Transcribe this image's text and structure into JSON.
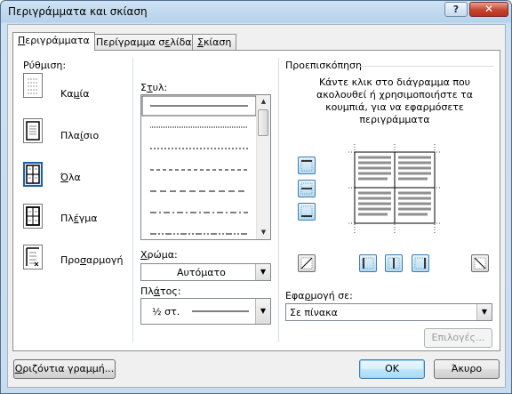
{
  "window": {
    "title": "Περιγράμματα και σκίαση",
    "help_label": "?",
    "close_label": "✕"
  },
  "tabs": [
    {
      "pre": "",
      "u": "Π",
      "post": "εριγράμματα"
    },
    {
      "pre": "Περίγραμμα σ",
      "u": "ε",
      "post": "λίδας"
    },
    {
      "pre": "",
      "u": "Σ",
      "post": "κίαση"
    }
  ],
  "setting": {
    "title": "Ρύθμιση:",
    "items": [
      {
        "label": "Καμία",
        "pre": "Κα",
        "u": "μ",
        "post": "ία",
        "icon": "border-none-icon"
      },
      {
        "label": "Πλαίσιο",
        "pre": "Πλα",
        "u": "ί",
        "post": "σιο",
        "icon": "border-box-icon"
      },
      {
        "label": "Όλα",
        "pre": "",
        "u": "Ό",
        "post": "λα",
        "icon": "border-all-icon",
        "selected": true
      },
      {
        "label": "Πλέγμα",
        "pre": "Πλ",
        "u": "έ",
        "post": "γμα",
        "icon": "border-grid-icon"
      },
      {
        "label": "Προσαρμογή",
        "pre": "Προ",
        "u": "σ",
        "post": "αρμογή",
        "icon": "border-custom-icon"
      }
    ]
  },
  "style": {
    "title_pre": "Σ",
    "title_u": "τ",
    "title_post": "υλ:",
    "line_styles": [
      "solid",
      "dotted-fine",
      "dotted",
      "dashed",
      "dashed-long",
      "dash-dot",
      "dash-dot-dot"
    ]
  },
  "color": {
    "label_pre": "",
    "label_u": "Χ",
    "label_post": "ρώμα:",
    "value": "Αυτόματο"
  },
  "width": {
    "label_pre": "Πλ",
    "label_u": "ά",
    "label_post": "τος:",
    "value": "½ στ."
  },
  "preview": {
    "title": "Προεπισκόπηση",
    "instructions": [
      "Κάντε κλικ στο διάγραμμα που",
      "ακολουθεί ή χρησιμοποιήστε τα",
      "κουμπιά, για να εφαρμόσετε",
      "περιγράμματα"
    ],
    "left_buttons": [
      "border-top-icon",
      "border-middle-horizontal-icon",
      "border-bottom-icon"
    ],
    "bottom_buttons": [
      "diagonal-down-icon",
      "border-left-icon",
      "border-middle-vertical-icon",
      "border-right-icon",
      "diagonal-up-icon"
    ]
  },
  "apply_to": {
    "label_pre": "Εφα",
    "label_u": "ρ",
    "label_post": "μογή σε:",
    "value": "Σε πίνακα"
  },
  "options_button": "Επιλογές...",
  "horizontal_line_button": {
    "pre": "",
    "u": "Ο",
    "post": "ριζόντια γραμμή..."
  },
  "ok_button": "OK",
  "cancel_button": "Άκυρο",
  "colors": {
    "title_bg": "#b9d1ea",
    "selected_border": "#1c5fb0",
    "panel_border": "#8e8f8f"
  }
}
